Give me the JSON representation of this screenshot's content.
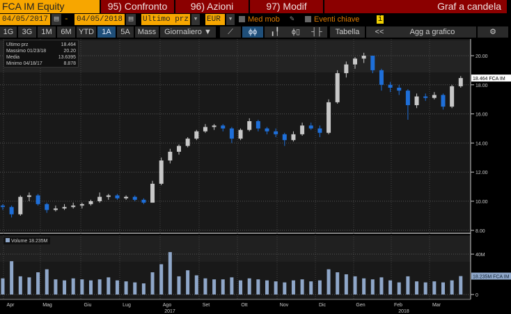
{
  "header": {
    "ticker": "FCA IM Equity",
    "compare": "95) Confronto",
    "actions": "96) Azioni",
    "modify": "97) Modif",
    "chart_type": "Graf a candela"
  },
  "controls": {
    "start_date": "04/05/2017",
    "dash": "-",
    "end_date": "04/05/2018",
    "field": "Ultimo prz",
    "currency": "EUR",
    "moving_avg": "Med mob",
    "key_events": "Eventi chiave",
    "info": "i"
  },
  "periods": [
    "1G",
    "3G",
    "1M",
    "6M",
    "YTD",
    "1A",
    "5A",
    "Mass"
  ],
  "active_period": "1A",
  "frequency": "Giornaliero ▼",
  "toolbar": {
    "table": "Tabella",
    "collapse": "<<",
    "add_to_chart": "Agg a grafico",
    "settings": "⚙"
  },
  "legend": [
    {
      "label": "Ultimo prz",
      "value": "18.464"
    },
    {
      "label": "Massimo 01/23/18",
      "value": "20.20"
    },
    {
      "label": "Media",
      "value": "13.6395"
    },
    {
      "label": "Minimo 04/18/17",
      "value": "8.878"
    }
  ],
  "colors": {
    "up": "#c8c8c8",
    "down": "#1e6fd9",
    "volume": "#8fa7c9",
    "accent": "#f7a600",
    "header_red": "#8b0000"
  },
  "chart_data": {
    "type": "candlestick",
    "y_ticks": [
      "20.00",
      "18.00",
      "16.00",
      "14.00",
      "12.00",
      "10.00",
      "8.00"
    ],
    "ylim": [
      7.9,
      21
    ],
    "last_label": "18.464 FCA IM",
    "x_labels": [
      "Apr",
      "Mag",
      "Giu",
      "Lug",
      "Ago",
      "Set",
      "Ott",
      "Nov",
      "Dic",
      "Gen",
      "Feb",
      "Mar"
    ],
    "year_labels": [
      "2017",
      "2018"
    ],
    "ohlc": [
      [
        9.7,
        9.8,
        9.4,
        9.6
      ],
      [
        9.6,
        9.7,
        8.88,
        9.1
      ],
      [
        9.1,
        10.4,
        9.0,
        10.3
      ],
      [
        10.3,
        10.6,
        10.0,
        10.4
      ],
      [
        10.4,
        10.5,
        9.7,
        9.8
      ],
      [
        9.8,
        9.9,
        9.2,
        9.4
      ],
      [
        9.4,
        9.7,
        9.3,
        9.5
      ],
      [
        9.5,
        9.8,
        9.4,
        9.6
      ],
      [
        9.6,
        9.9,
        9.5,
        9.7
      ],
      [
        9.7,
        9.9,
        9.5,
        9.8
      ],
      [
        9.8,
        10.1,
        9.7,
        10.0
      ],
      [
        10.0,
        10.6,
        9.9,
        10.3
      ],
      [
        10.3,
        10.5,
        10.1,
        10.4
      ],
      [
        10.4,
        10.5,
        10.1,
        10.2
      ],
      [
        10.2,
        10.4,
        10.1,
        10.3
      ],
      [
        10.3,
        10.4,
        10.0,
        10.1
      ],
      [
        10.1,
        10.2,
        9.8,
        9.9
      ],
      [
        9.9,
        11.4,
        9.9,
        11.2
      ],
      [
        11.2,
        13.0,
        11.1,
        12.8
      ],
      [
        12.8,
        13.6,
        12.6,
        13.4
      ],
      [
        13.4,
        13.9,
        13.2,
        13.8
      ],
      [
        13.8,
        14.4,
        13.7,
        14.3
      ],
      [
        14.3,
        14.9,
        14.2,
        14.8
      ],
      [
        14.8,
        15.3,
        14.7,
        15.1
      ],
      [
        15.1,
        15.3,
        14.9,
        15.2
      ],
      [
        15.2,
        15.3,
        14.8,
        15.0
      ],
      [
        15.0,
        15.1,
        14.0,
        14.3
      ],
      [
        14.3,
        15.0,
        14.2,
        14.9
      ],
      [
        14.9,
        15.7,
        14.8,
        15.5
      ],
      [
        15.5,
        15.6,
        14.8,
        15.0
      ],
      [
        15.0,
        15.1,
        14.6,
        14.8
      ],
      [
        14.8,
        15.0,
        14.4,
        14.6
      ],
      [
        14.6,
        14.7,
        13.8,
        14.2
      ],
      [
        14.2,
        14.8,
        14.1,
        14.6
      ],
      [
        14.6,
        15.4,
        14.5,
        15.2
      ],
      [
        15.2,
        15.4,
        14.9,
        15.0
      ],
      [
        15.0,
        15.2,
        14.4,
        14.7
      ],
      [
        14.7,
        17.0,
        14.6,
        16.8
      ],
      [
        16.8,
        19.0,
        16.7,
        18.8
      ],
      [
        18.8,
        19.6,
        18.5,
        19.4
      ],
      [
        19.4,
        19.9,
        19.1,
        19.8
      ],
      [
        19.8,
        20.2,
        19.5,
        20.0
      ],
      [
        20.0,
        20.0,
        18.8,
        19.0
      ],
      [
        19.0,
        19.1,
        17.6,
        18.0
      ],
      [
        18.0,
        18.2,
        17.5,
        17.8
      ],
      [
        17.8,
        18.0,
        17.3,
        17.6
      ],
      [
        17.6,
        17.7,
        15.6,
        16.6
      ],
      [
        16.6,
        17.4,
        16.4,
        17.2
      ],
      [
        17.2,
        17.4,
        16.9,
        17.1
      ],
      [
        17.1,
        17.5,
        17.0,
        17.3
      ],
      [
        17.3,
        17.4,
        16.3,
        16.5
      ],
      [
        16.5,
        18.0,
        16.4,
        17.9
      ],
      [
        17.9,
        18.6,
        17.8,
        18.464
      ]
    ],
    "volume": {
      "label": "Volume 18.235M",
      "last_label": "18.235M FCA IM",
      "y_ticks": [
        "40M",
        "0"
      ],
      "ylim": [
        0,
        45
      ],
      "values": [
        16,
        33,
        18,
        17,
        22,
        25,
        15,
        14,
        16,
        15,
        14,
        15,
        17,
        14,
        13,
        12,
        11,
        22,
        30,
        42,
        18,
        24,
        19,
        16,
        15,
        15,
        17,
        14,
        16,
        15,
        14,
        13,
        12,
        14,
        15,
        13,
        14,
        25,
        22,
        20,
        18,
        16,
        15,
        17,
        14,
        12,
        18,
        13,
        12,
        13,
        12,
        14,
        18.235
      ]
    }
  }
}
